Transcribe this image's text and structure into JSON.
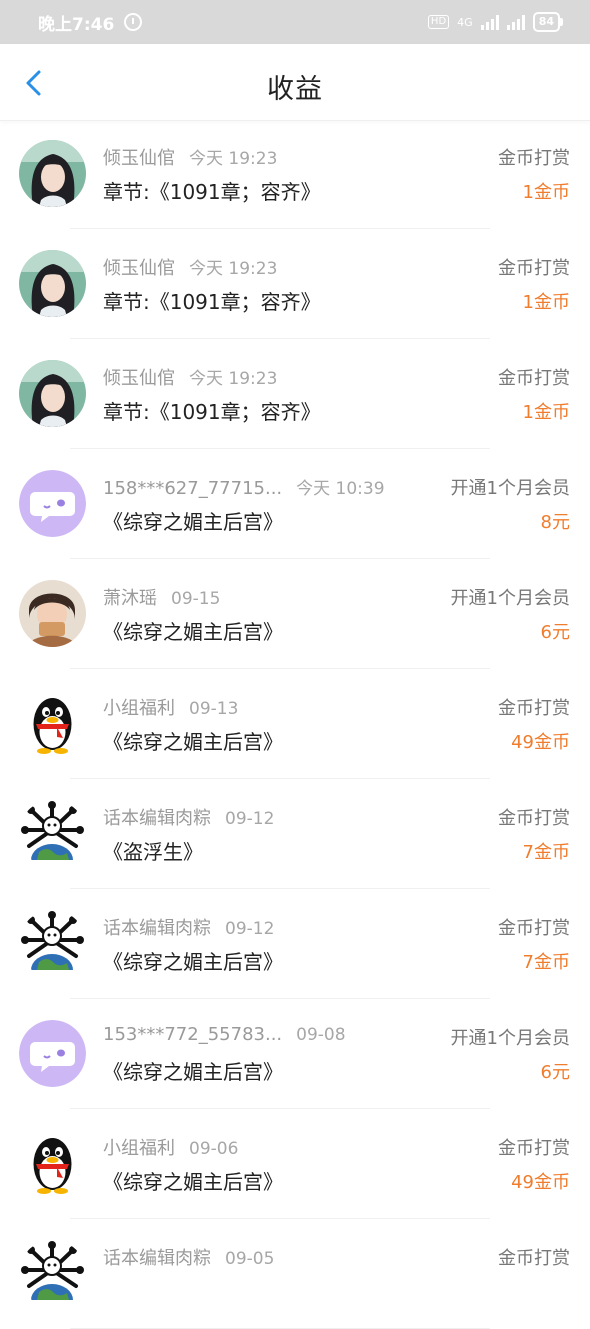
{
  "status_bar": {
    "time": "晚上7:46",
    "hd": "HD",
    "network": "4G",
    "battery": "84"
  },
  "header": {
    "title": "收益"
  },
  "colors": {
    "accent_blue": "#2a8fe6",
    "amount_orange": "#f07d2e"
  },
  "records": [
    {
      "avatar": "portrait-avatar",
      "name": "倾玉仙倌",
      "time": "今天 19:23",
      "title": "章节:《1091章；容齐》",
      "type": "金币打赏",
      "amount": "1金币"
    },
    {
      "avatar": "portrait-avatar",
      "name": "倾玉仙倌",
      "time": "今天 19:23",
      "title": "章节:《1091章；容齐》",
      "type": "金币打赏",
      "amount": "1金币"
    },
    {
      "avatar": "portrait-avatar",
      "name": "倾玉仙倌",
      "time": "今天 19:23",
      "title": "章节:《1091章；容齐》",
      "type": "金币打赏",
      "amount": "1金币"
    },
    {
      "avatar": "chat-bubble-avatar",
      "name": "158***627_77715...",
      "time": "今天 10:39",
      "title": "《综穿之媚主后宫》",
      "type": "开通1个月会员",
      "amount": "8元"
    },
    {
      "avatar": "child-photo-avatar",
      "name": "萧沐瑶",
      "time": "09-15",
      "title": "《综穿之媚主后宫》",
      "type": "开通1个月会员",
      "amount": "6元"
    },
    {
      "avatar": "penguin-avatar",
      "name": "小组福利",
      "time": "09-13",
      "title": "《综穿之媚主后宫》",
      "type": "金币打赏",
      "amount": "49金币"
    },
    {
      "avatar": "globe-creature-avatar",
      "name": "话本编辑肉粽",
      "time": "09-12",
      "title": "《盗浮生》",
      "type": "金币打赏",
      "amount": "7金币"
    },
    {
      "avatar": "globe-creature-avatar",
      "name": "话本编辑肉粽",
      "time": "09-12",
      "title": "《综穿之媚主后宫》",
      "type": "金币打赏",
      "amount": "7金币"
    },
    {
      "avatar": "chat-bubble-avatar",
      "name": "153***772_55783...",
      "time": "09-08",
      "title": "《综穿之媚主后宫》",
      "type": "开通1个月会员",
      "amount": "6元"
    },
    {
      "avatar": "penguin-avatar",
      "name": "小组福利",
      "time": "09-06",
      "title": "《综穿之媚主后宫》",
      "type": "金币打赏",
      "amount": "49金币"
    },
    {
      "avatar": "globe-creature-avatar",
      "name": "话本编辑肉粽",
      "time": "09-05",
      "title": "",
      "type": "金币打赏",
      "amount": ""
    }
  ]
}
